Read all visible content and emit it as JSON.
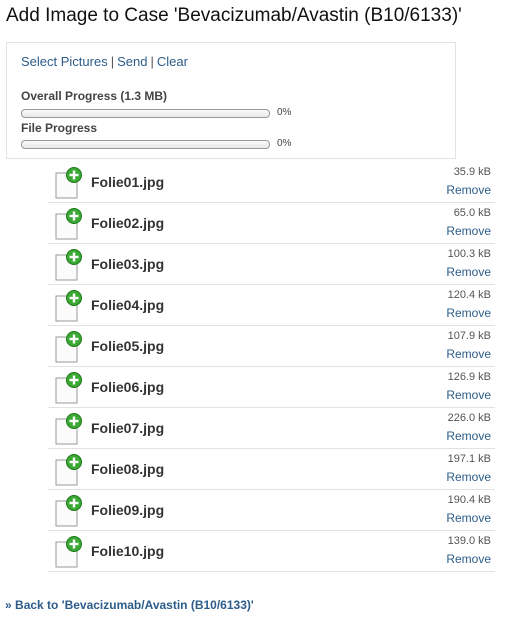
{
  "page": {
    "title": "Add Image to Case 'Bevacizumab/Avastin (B10/6133)'"
  },
  "actions": {
    "select": "Select Pictures",
    "send": "Send",
    "clear": "Clear",
    "separator": "|"
  },
  "progress": {
    "overall": {
      "label": "Overall Progress (1.3 MB)",
      "percent_text": "0%",
      "value": 0
    },
    "file": {
      "label": "File Progress",
      "percent_text": "0%",
      "value": 0
    }
  },
  "files": [
    {
      "name": "Folie01.jpg",
      "size": "35.9 kB",
      "remove": "Remove",
      "icon": "image-file-add-icon"
    },
    {
      "name": "Folie02.jpg",
      "size": "65.0 kB",
      "remove": "Remove",
      "icon": "image-file-add-icon"
    },
    {
      "name": "Folie03.jpg",
      "size": "100.3 kB",
      "remove": "Remove",
      "icon": "image-file-add-icon"
    },
    {
      "name": "Folie04.jpg",
      "size": "120.4 kB",
      "remove": "Remove",
      "icon": "image-file-add-icon"
    },
    {
      "name": "Folie05.jpg",
      "size": "107.9 kB",
      "remove": "Remove",
      "icon": "image-file-add-icon"
    },
    {
      "name": "Folie06.jpg",
      "size": "126.9 kB",
      "remove": "Remove",
      "icon": "image-file-add-icon"
    },
    {
      "name": "Folie07.jpg",
      "size": "226.0 kB",
      "remove": "Remove",
      "icon": "image-file-add-icon"
    },
    {
      "name": "Folie08.jpg",
      "size": "197.1 kB",
      "remove": "Remove",
      "icon": "image-file-add-icon"
    },
    {
      "name": "Folie09.jpg",
      "size": "190.4 kB",
      "remove": "Remove",
      "icon": "image-file-add-icon"
    },
    {
      "name": "Folie10.jpg",
      "size": "139.0 kB",
      "remove": "Remove",
      "icon": "image-file-add-icon"
    }
  ],
  "back": {
    "arrow": "»",
    "label": "Back to 'Bevacizumab/Avastin (B10/6133)'"
  },
  "colors": {
    "link": "#2c5c8a",
    "add_badge": "#3aa832",
    "panel_border": "#e3e3e3"
  }
}
